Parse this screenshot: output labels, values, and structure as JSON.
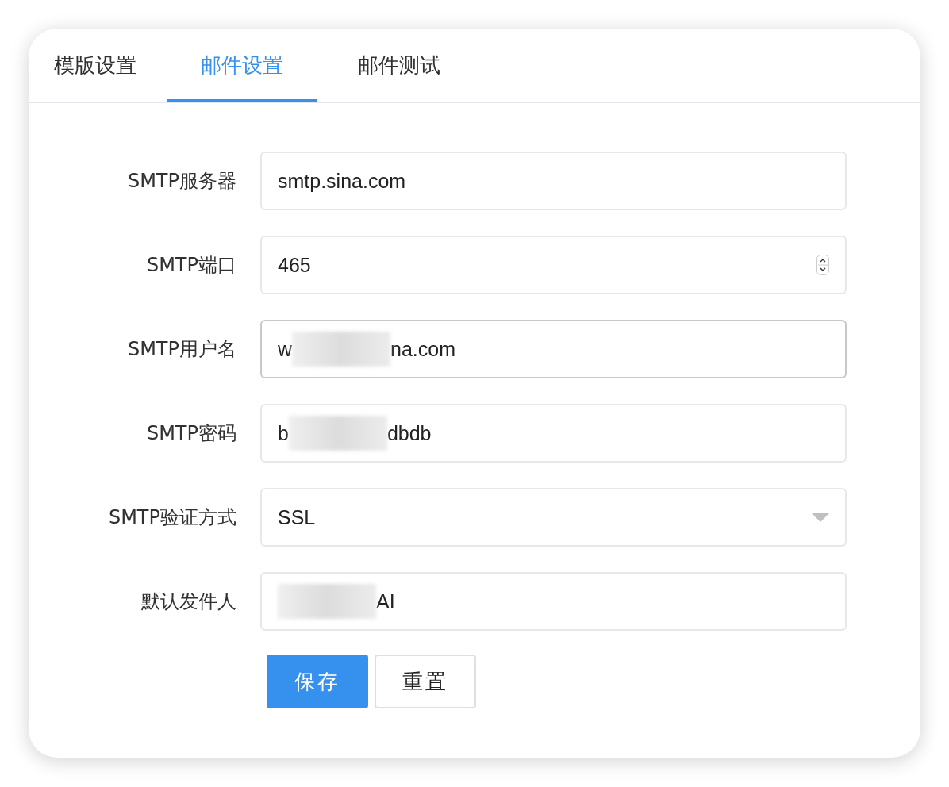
{
  "tabs": [
    {
      "label": "模版设置",
      "selected": false
    },
    {
      "label": "邮件设置",
      "selected": true
    },
    {
      "label": "邮件测试",
      "selected": false
    }
  ],
  "form": {
    "fields": [
      {
        "label": "SMTP服务器",
        "kind": "text",
        "value_start": "smtp.sina.com",
        "redacted": false,
        "focused": false
      },
      {
        "label": "SMTP端口",
        "kind": "number",
        "value_start": "465",
        "redacted": false,
        "focused": false
      },
      {
        "label": "SMTP用户名",
        "kind": "text",
        "value_start": "w",
        "value_end": "na.com",
        "redacted": true,
        "focused": true
      },
      {
        "label": "SMTP密码",
        "kind": "text",
        "value_start": "b",
        "value_end": "dbdb",
        "redacted": true,
        "focused": false
      },
      {
        "label": "SMTP验证方式",
        "kind": "select",
        "value_start": "SSL",
        "redacted": false,
        "focused": false
      },
      {
        "label": "默认发件人",
        "kind": "text",
        "value_end": "AI",
        "redacted": true,
        "focused": false
      }
    ],
    "buttons": [
      {
        "label": "保存",
        "kind": "primary"
      },
      {
        "label": "重置",
        "kind": "default"
      }
    ]
  }
}
